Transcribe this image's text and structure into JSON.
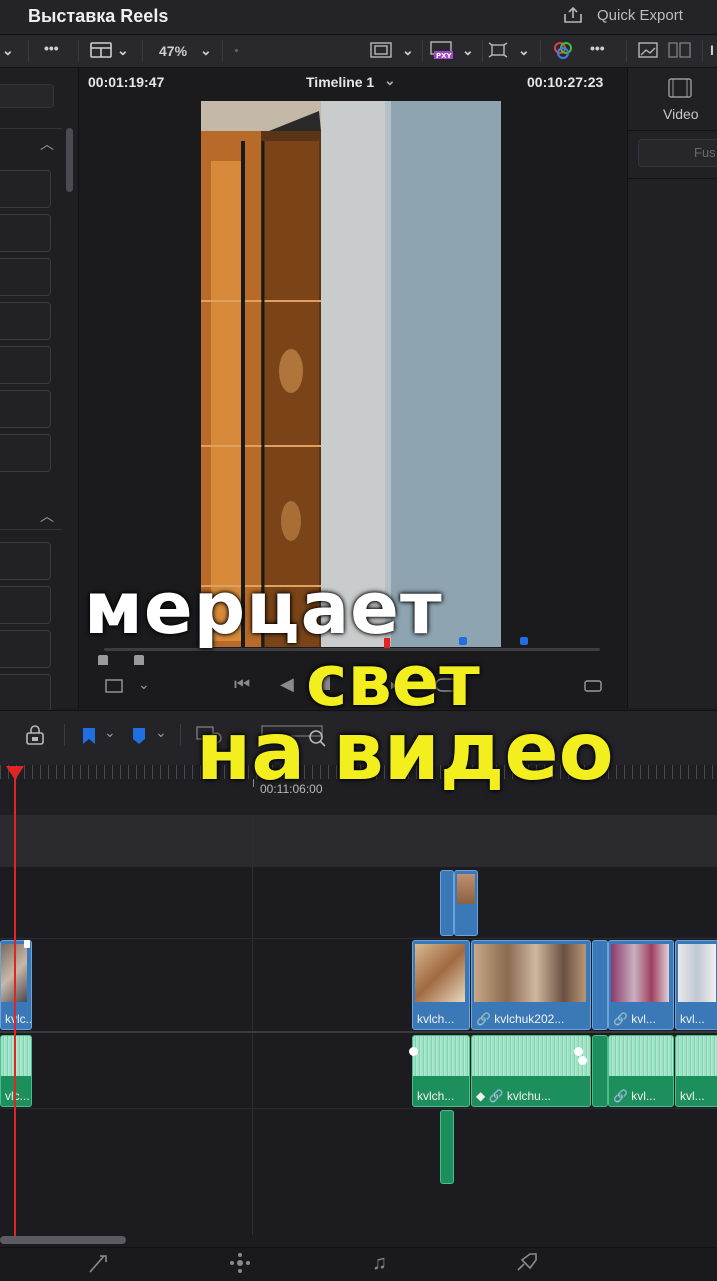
{
  "app": {
    "title": "Выставка Reels",
    "quick_export": "Quick Export"
  },
  "toolbar": {
    "zoom": "47%",
    "more": "•••"
  },
  "viewer": {
    "timecode_left": "00:01:19:47",
    "timeline_name": "Timeline 1",
    "timecode_right": "00:10:27:23"
  },
  "inspector": {
    "tab_video": "Video",
    "tab_fusion": "Fus"
  },
  "timeline": {
    "ruler_timecode": "00:11:06:00",
    "clips_v1": [
      "kvlc...",
      "kvlch...",
      "kvlchuk202...",
      "kvl...",
      "kvl..."
    ],
    "clips_a1": [
      "vlc...",
      "kvlch...",
      "kvlchu...",
      "kvl...",
      "kvl..."
    ]
  },
  "overlay": {
    "line1": "мерцает",
    "line2": "свет",
    "line3": "на видео"
  },
  "colors": {
    "playhead": "#e02525",
    "video_clip": "#3a78b8",
    "audio_clip": "#1c8f5c",
    "overlay_yellow": "#f3ef1f",
    "marker_blue": "#1f6fe0"
  },
  "icons": [
    "quick-export-icon",
    "viewer-layout-icon",
    "safe-area-icon",
    "proxy-icon",
    "transform-icon",
    "color-icon",
    "video-tab-icon",
    "lock-icon",
    "flag-icon",
    "marker-icon",
    "zoom-icon",
    "skip-start-icon",
    "stop-icon",
    "loop-icon",
    "fullscreen-icon",
    "edit-page-icon",
    "fusion-page-icon",
    "fairlight-page-icon",
    "deliver-page-icon"
  ]
}
